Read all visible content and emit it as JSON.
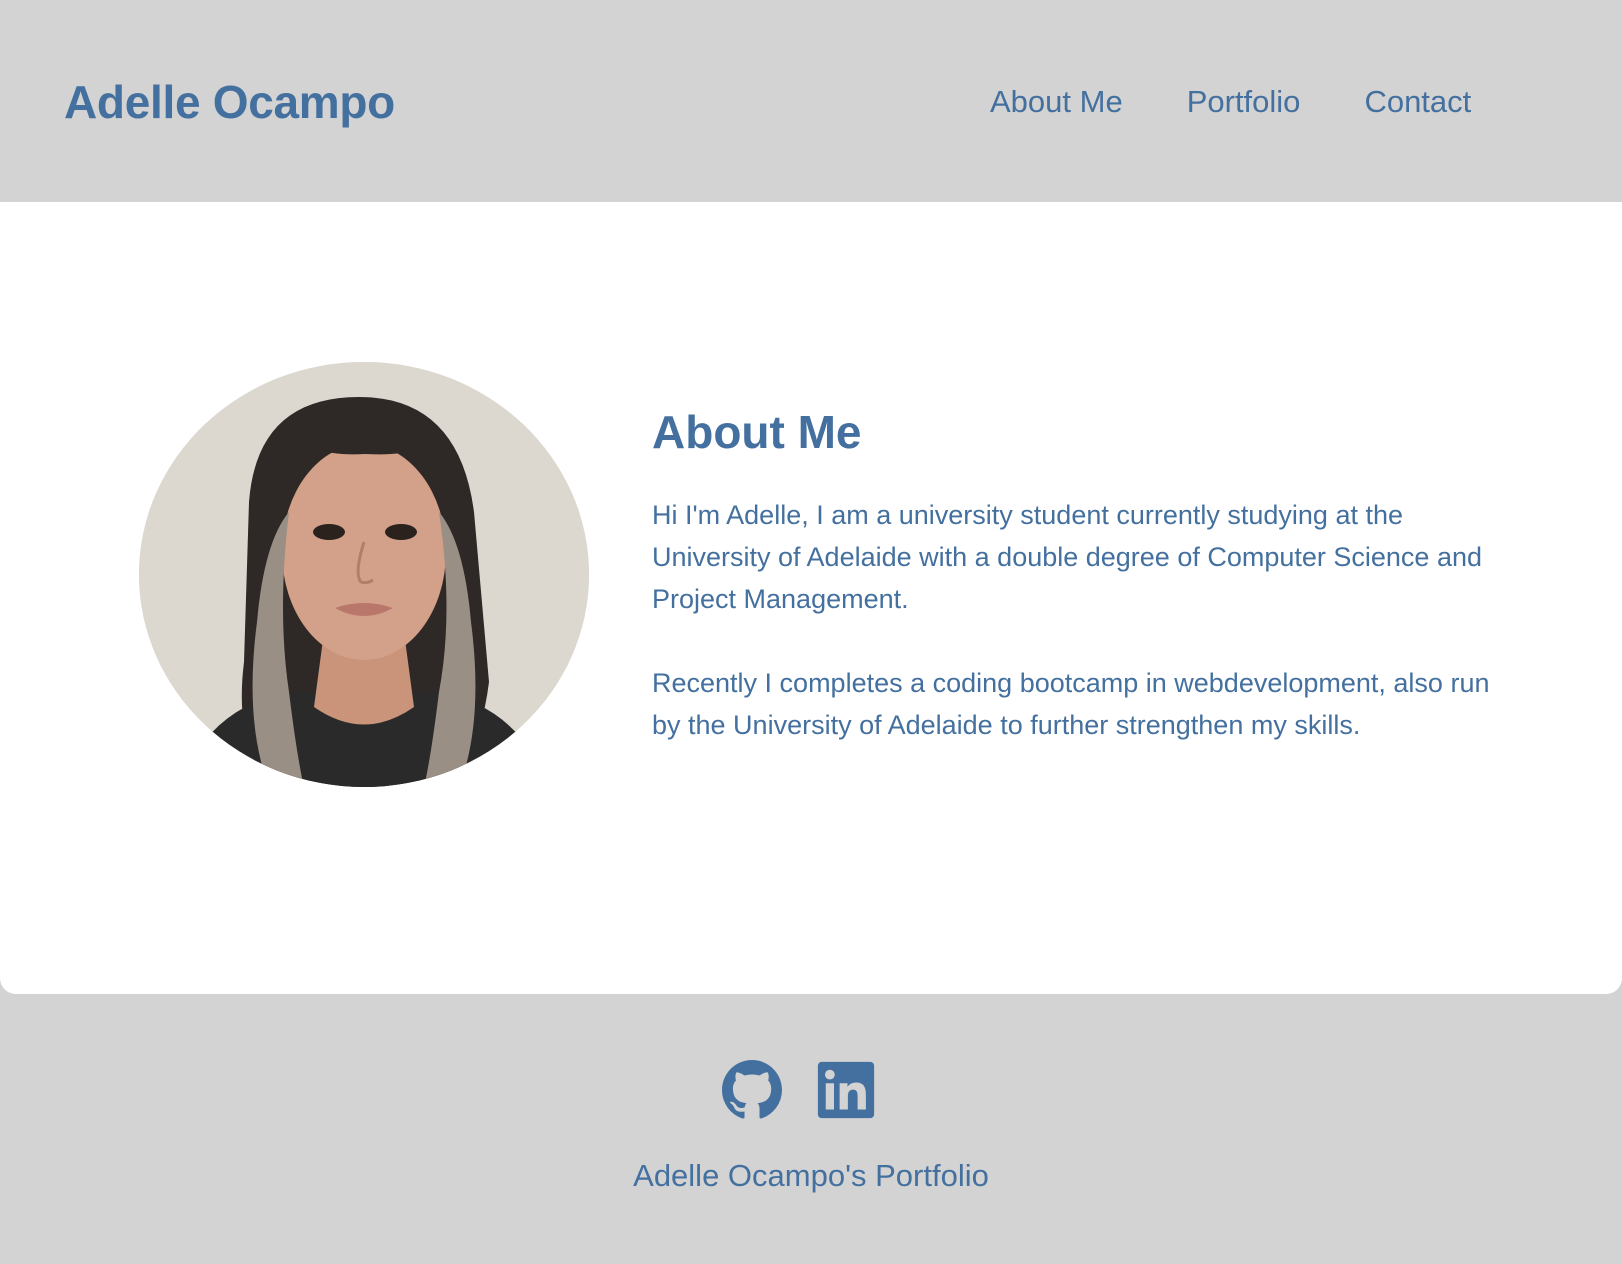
{
  "header": {
    "title": "Adelle Ocampo",
    "nav": [
      {
        "label": "About Me"
      },
      {
        "label": "Portfolio"
      },
      {
        "label": "Contact"
      }
    ]
  },
  "about": {
    "heading": "About Me",
    "paragraphs": [
      "Hi I'm Adelle, I am a university student currently studying at the University of Adelaide with a double degree of Computer Science and Project Management.",
      "Recently I completes a coding bootcamp in webdevelopment, also run by the University of Adelaide to further strengthen my skills."
    ],
    "photo_icon": "profile-photo"
  },
  "footer": {
    "social": [
      {
        "icon": "github-icon"
      },
      {
        "icon": "linkedin-icon"
      }
    ],
    "text": "Adelle Ocampo's Portfolio"
  },
  "colors": {
    "accent": "#44709f",
    "header_bg": "#d3d3d3",
    "main_bg": "#ffffff"
  }
}
